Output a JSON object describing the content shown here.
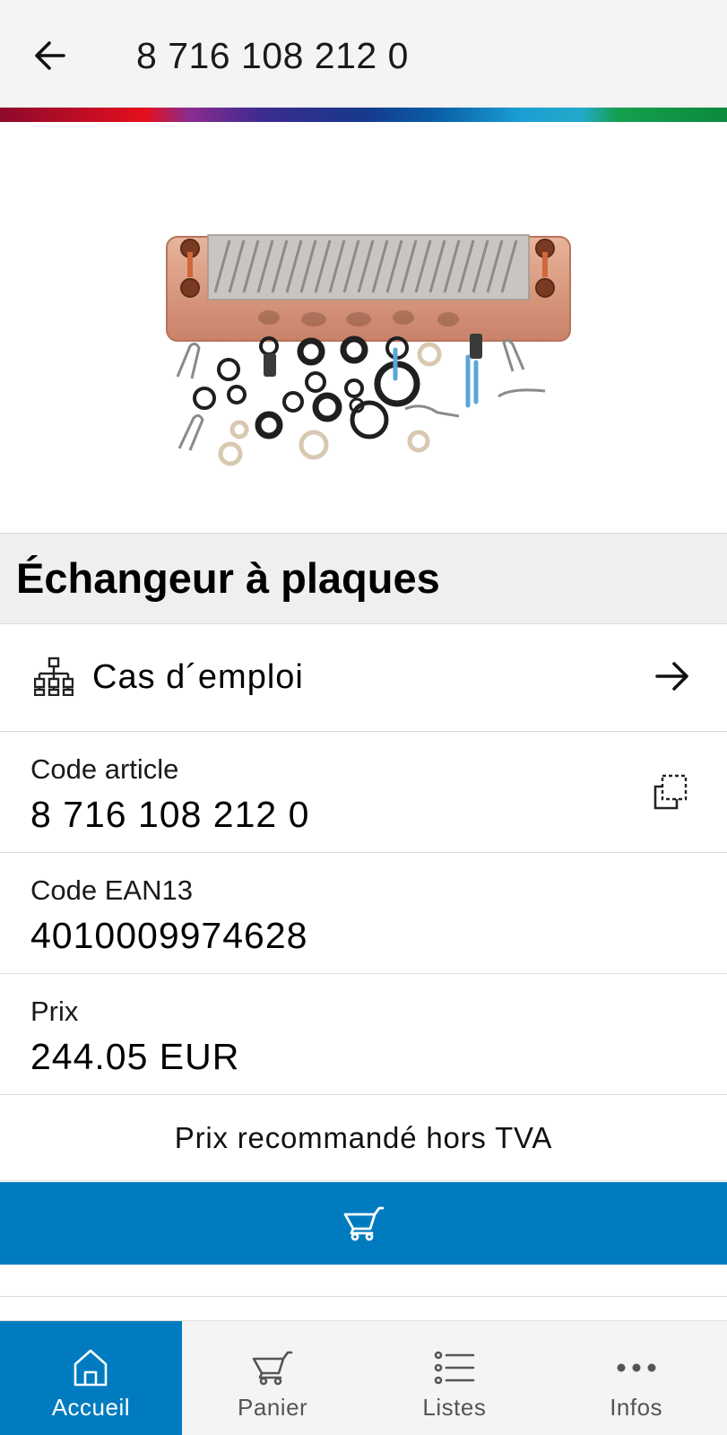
{
  "header": {
    "title": "8 716 108 212 0",
    "back_icon": "arrow-left-icon"
  },
  "colors": {
    "primary": "#007bc0",
    "header_bg": "#f4f4f4",
    "title_band_bg": "#efefef",
    "supergraphic": [
      "#a80b2f",
      "#e00f1e",
      "#7a2a8c",
      "#3a2a92",
      "#173d8f",
      "#0a64a8",
      "#1b9ad1",
      "#16a354",
      "#0e8a3f"
    ]
  },
  "product": {
    "image_alt": "plate-heat-exchanger-kit-image",
    "title": "Échangeur à plaques"
  },
  "where_used": {
    "label": "Cas d´emploi",
    "icon": "hierarchy-icon",
    "arrow_icon": "arrow-right-icon"
  },
  "details": {
    "article_code_label": "Code article",
    "article_code_value": "8 716 108 212 0",
    "copy_icon": "copy-icon",
    "ean_label": "Code EAN13",
    "ean_value": "4010009974628",
    "price_label": "Prix",
    "price_value": "244.05 EUR",
    "price_note": "Prix recommandé hors TVA"
  },
  "cart_button": {
    "icon": "cart-icon"
  },
  "bottom_nav": {
    "items": [
      {
        "label": "Accueil",
        "icon": "home-icon",
        "active": true
      },
      {
        "label": "Panier",
        "icon": "cart-icon",
        "active": false
      },
      {
        "label": "Listes",
        "icon": "list-icon",
        "active": false
      },
      {
        "label": "Infos",
        "icon": "more-dots-icon",
        "active": false
      }
    ]
  }
}
